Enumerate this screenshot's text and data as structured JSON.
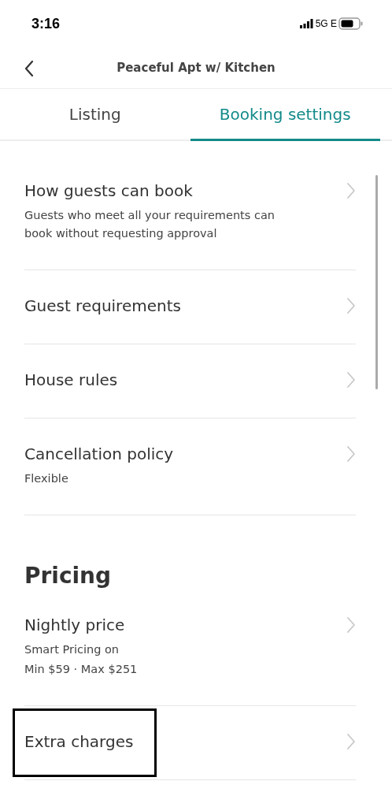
{
  "status_bar": {
    "time": "3:16",
    "network": "5G E"
  },
  "nav": {
    "title": "Peaceful Apt w/ Kitchen"
  },
  "tabs": [
    {
      "label": "Listing",
      "selected": false
    },
    {
      "label": "Booking settings",
      "selected": true
    }
  ],
  "sections": [
    {
      "items": [
        {
          "title": "How guests can book",
          "description": [
            "Guests who meet all your requirements can book without requesting approval"
          ],
          "highlighted": false
        },
        {
          "title": "Guest requirements",
          "highlighted": false
        },
        {
          "title": "House rules",
          "highlighted": false
        },
        {
          "title": "Cancellation policy",
          "description": [
            "Flexible"
          ],
          "highlighted": false
        }
      ]
    },
    {
      "heading": "Pricing",
      "items": [
        {
          "title": "Nightly price",
          "description": [
            "Smart Pricing on",
            "Min $59 · Max $251"
          ],
          "highlighted": false
        },
        {
          "title": "Extra charges",
          "highlighted": true
        }
      ]
    }
  ]
}
